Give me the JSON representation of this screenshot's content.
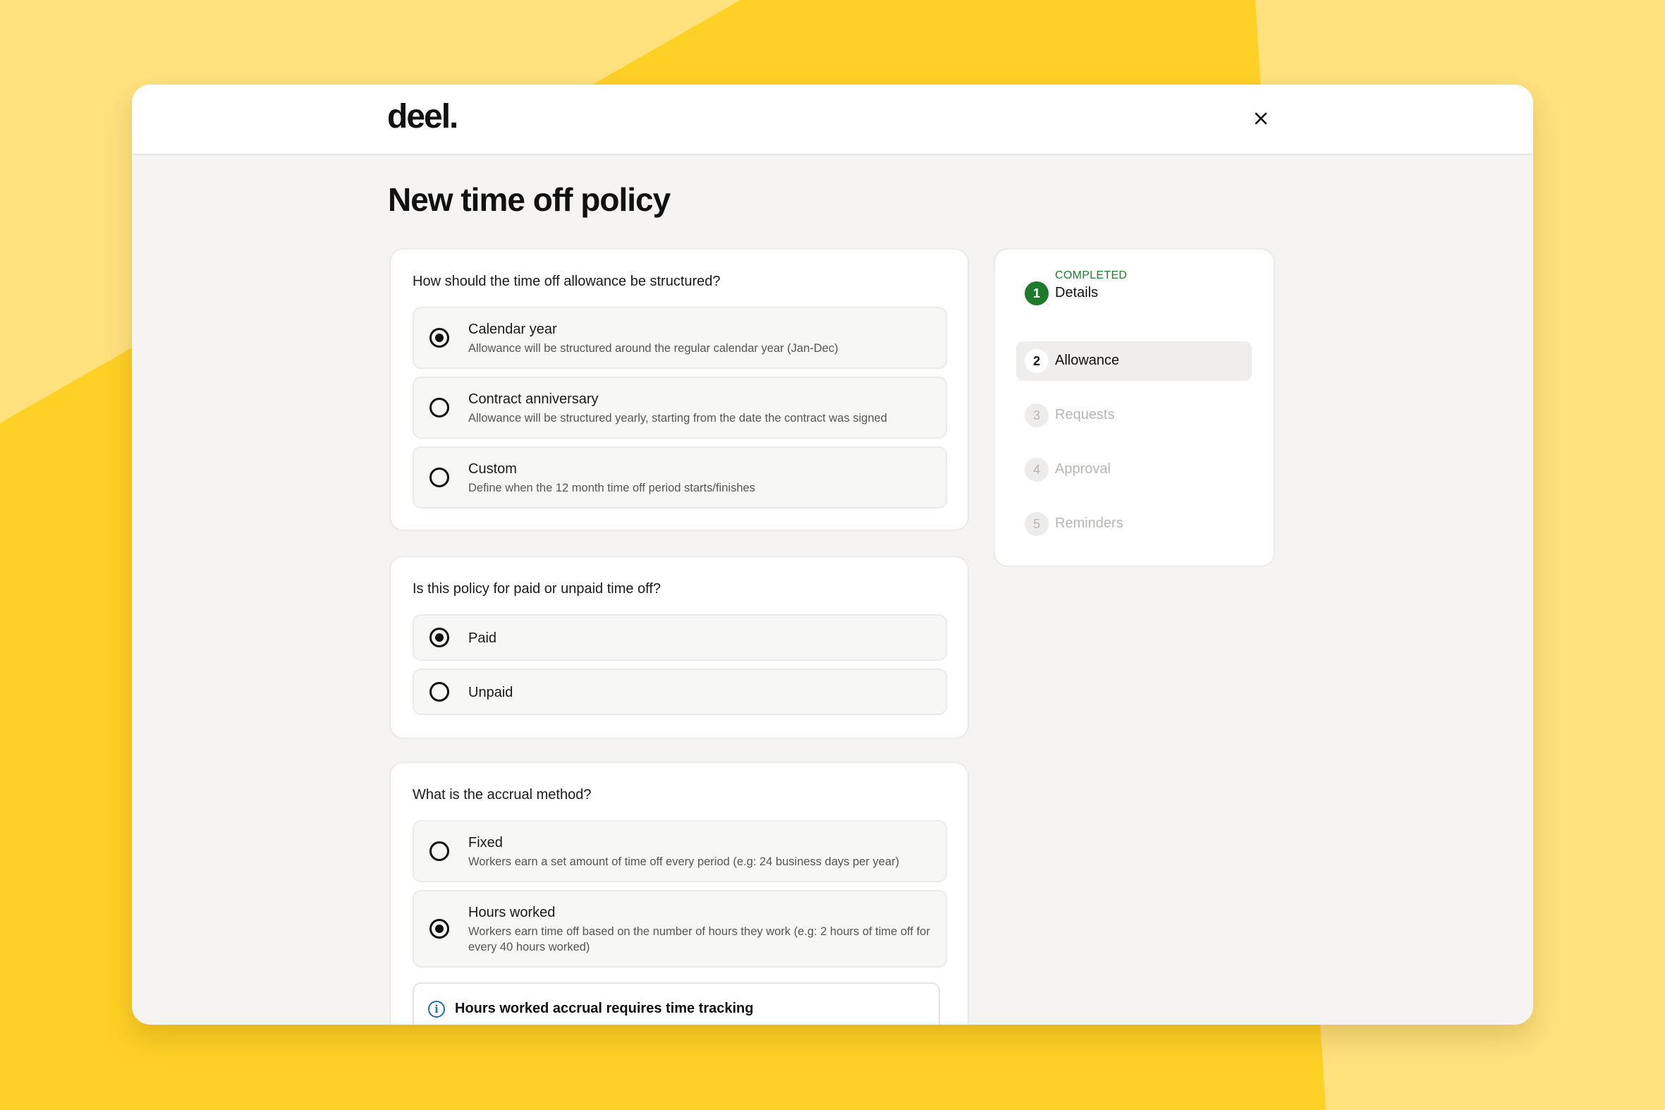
{
  "app": {
    "logo": "deel."
  },
  "page": {
    "title": "New time off policy"
  },
  "structure": {
    "question": "How should the time off allowance be structured?",
    "options": [
      {
        "title": "Calendar year",
        "description": "Allowance will be structured around the regular calendar year (Jan-Dec)",
        "selected": true
      },
      {
        "title": "Contract anniversary",
        "description": "Allowance will be structured yearly, starting from the date the contract was signed",
        "selected": false
      },
      {
        "title": "Custom",
        "description": "Define when the 12 month time off period starts/finishes",
        "selected": false
      }
    ]
  },
  "paid": {
    "question": "Is this policy for paid or unpaid time off?",
    "options": [
      {
        "title": "Paid",
        "selected": true
      },
      {
        "title": "Unpaid",
        "selected": false
      }
    ]
  },
  "accrual": {
    "question": "What is the accrual method?",
    "options": [
      {
        "title": "Fixed",
        "description": "Workers earn a set amount of time off every period (e.g: 24 business days per year)",
        "selected": false
      },
      {
        "title": "Hours worked",
        "description": "Workers earn time off based on the number of hours they work (e.g: 2 hours of time off for every 40 hours worked)",
        "selected": true
      }
    ],
    "notice": "Hours worked accrual requires time tracking"
  },
  "steps": [
    {
      "number": "1",
      "label": "Details",
      "status": "COMPLETED",
      "state": "completed"
    },
    {
      "number": "2",
      "label": "Allowance",
      "state": "current"
    },
    {
      "number": "3",
      "label": "Requests",
      "state": "upcoming"
    },
    {
      "number": "4",
      "label": "Approval",
      "state": "upcoming"
    },
    {
      "number": "5",
      "label": "Reminders",
      "state": "upcoming"
    }
  ],
  "colors": {
    "background": "#FFE17E",
    "background_accent": "#FFD026",
    "completed_green": "#1E7B2C",
    "info_blue": "#1F6FB2"
  }
}
